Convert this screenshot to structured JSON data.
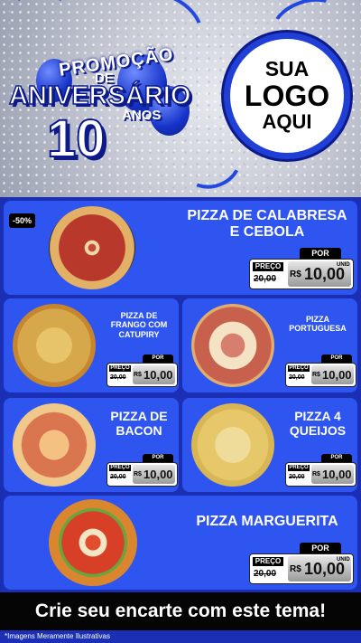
{
  "header": {
    "promo_title": "PROMOÇÃO",
    "promo_de": "DE",
    "promo_aniversario": "ANIVERSÁRIO",
    "promo_anos": "ANOS",
    "promo_number": "10",
    "logo_line1": "SUA",
    "logo_line2": "LOGO",
    "logo_line3": "AQUI"
  },
  "colors": {
    "primary_blue": "#1a2fb4",
    "card_blue": "#2f55f0",
    "black": "#050505"
  },
  "discount_badge": "-50%",
  "price_labels": {
    "por": "POR",
    "preco": "PREÇO",
    "currency": "R$",
    "unit": "UNID"
  },
  "items": [
    {
      "name_line1": "PIZZA DE CALABRESA",
      "name_line2": "E CEBOLA",
      "old_price": "20,00",
      "new_price": "10,00"
    },
    {
      "name_line1": "PIZZA DE",
      "name_line2": "FRANGO COM",
      "name_line3": "CATUPIRY",
      "old_price": "20,00",
      "new_price": "10,00"
    },
    {
      "name_line1": "PIZZA",
      "name_line2": "PORTUGUESA",
      "old_price": "20,00",
      "new_price": "10,00"
    },
    {
      "name_line1": "PIZZA DE",
      "name_line2": "BACON",
      "old_price": "20,00",
      "new_price": "10,00"
    },
    {
      "name_line1": "PIZZA 4",
      "name_line2": "QUEIJOS",
      "old_price": "20,00",
      "new_price": "10,00"
    },
    {
      "name_line1": "PIZZA MARGUERITA",
      "old_price": "20,00",
      "new_price": "10,00"
    }
  ],
  "footer": {
    "cta": "Crie seu encarte com este tema!",
    "note": "*Imagens Meramente Ilustrativas"
  }
}
